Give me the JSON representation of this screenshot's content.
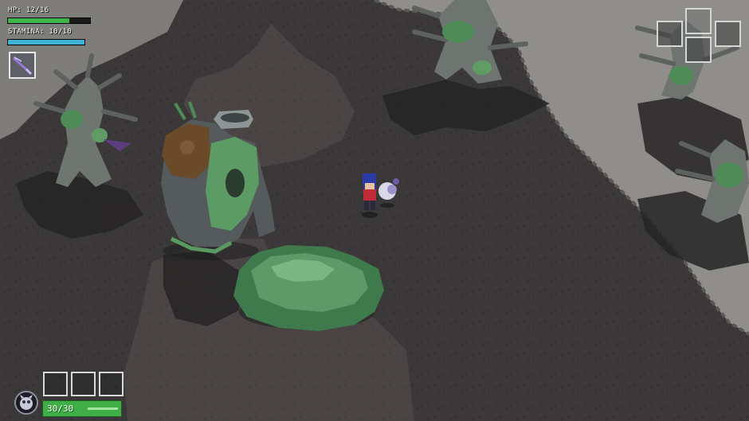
{
  "hud": {
    "hp_label": "HP: 12/16",
    "hp_fraction": 0.75,
    "stamina_label": "STAMINA: 10/10",
    "stamina_fraction": 1.0,
    "equipped_weapon": "purple-sword-icon",
    "companion_icon": "companion-creature-icon",
    "ammo_label": "30/30",
    "ammo_fraction": 1.0,
    "item_slots": [
      "",
      "",
      ""
    ]
  },
  "colors": {
    "hp_bar": "#3fb548",
    "stamina_bar": "#3db3d7",
    "ammo_bar": "#3fae46",
    "ground_dark": "#3a3838",
    "ground_light": "#4a4544",
    "pale_ground": "#8f8e8b",
    "moss": "#4f8b57"
  }
}
